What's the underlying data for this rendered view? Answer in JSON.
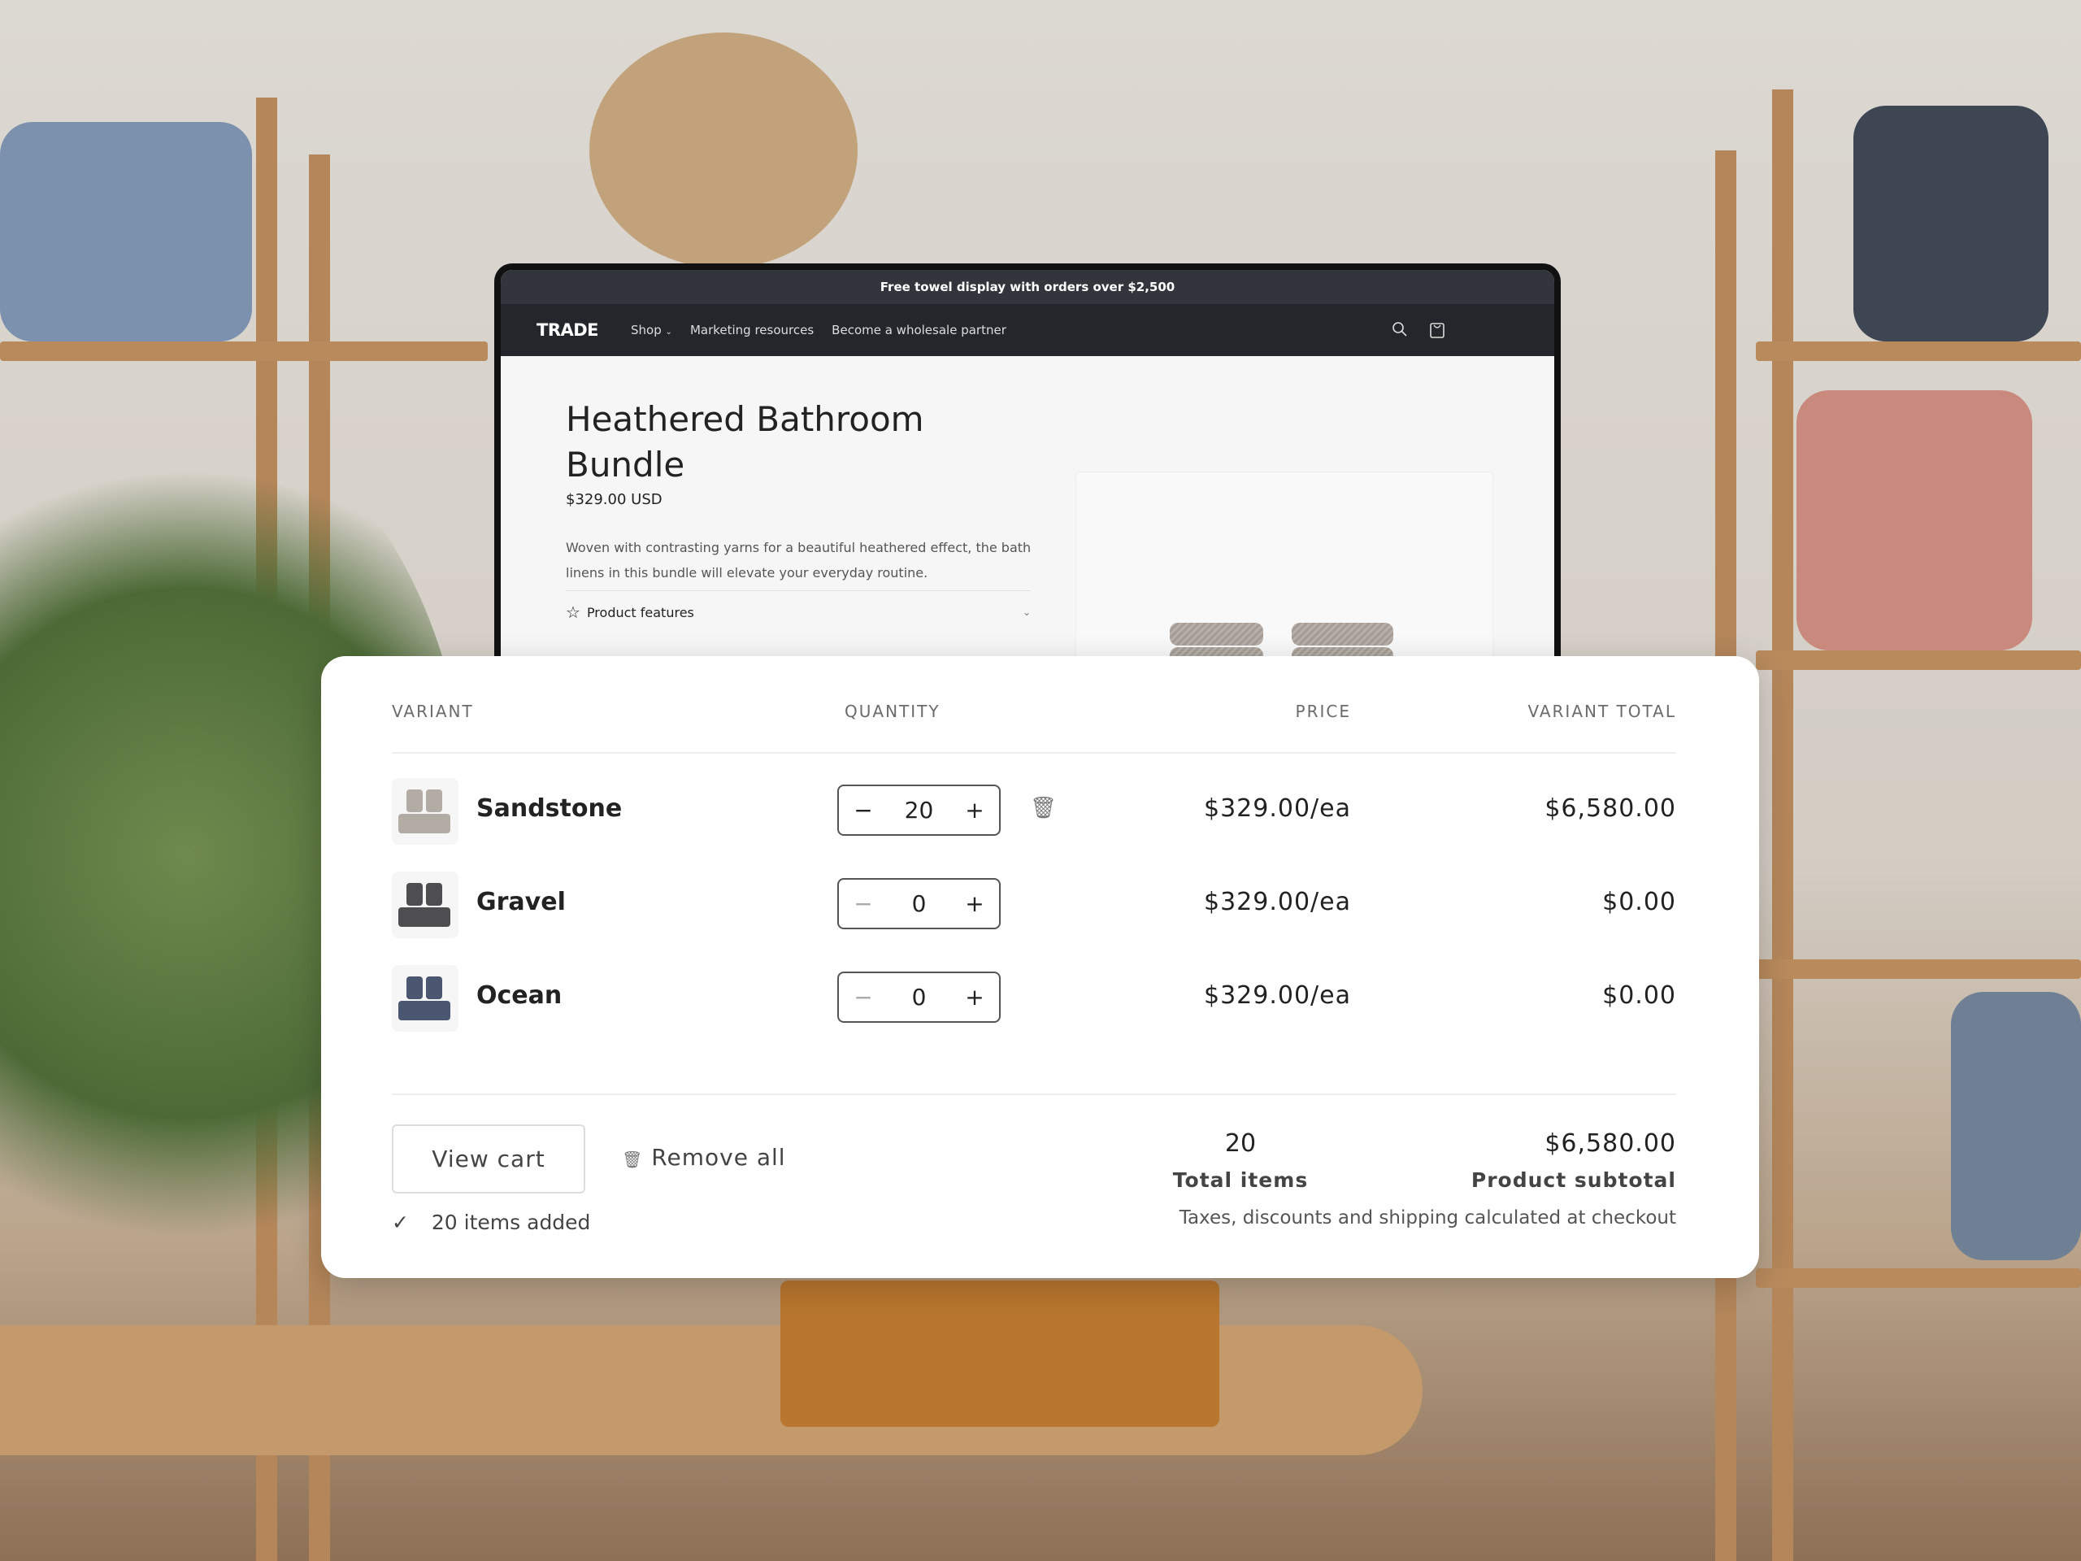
{
  "storefront": {
    "announcement": "Free towel display with orders over $2,500",
    "logo": "TRADE",
    "nav": [
      "Shop",
      "Marketing resources",
      "Become a wholesale partner"
    ],
    "icons": [
      "search-icon",
      "cart-icon"
    ],
    "product": {
      "title": "Heathered Bathroom Bundle",
      "price": "$329.00 USD",
      "description": "Woven with contrasting yarns for a beautiful heathered effect, the bath linens in this bundle will elevate your everyday routine.",
      "features_label": "Product features"
    }
  },
  "order_panel": {
    "headers": {
      "variant": "VARIANT",
      "quantity": "QUANTITY",
      "price": "PRICE",
      "total": "VARIANT TOTAL"
    },
    "rows": [
      {
        "name": "Sandstone",
        "qty": "20",
        "price": "$329.00/ea",
        "total": "$6,580.00",
        "color": "#b3aca5"
      },
      {
        "name": "Gravel",
        "qty": "0",
        "price": "$329.00/ea",
        "total": "$0.00",
        "color": "#4e4e50"
      },
      {
        "name": "Ocean",
        "qty": "0",
        "price": "$329.00/ea",
        "total": "$0.00",
        "color": "#4b5670"
      }
    ],
    "view_cart": "View cart",
    "remove_all": "Remove all",
    "items_added": "20 items added",
    "total_items_value": "20",
    "total_items_label": "Total items",
    "subtotal_value": "$6,580.00",
    "subtotal_label": "Product subtotal",
    "note": "Taxes, discounts and shipping calculated at checkout"
  }
}
